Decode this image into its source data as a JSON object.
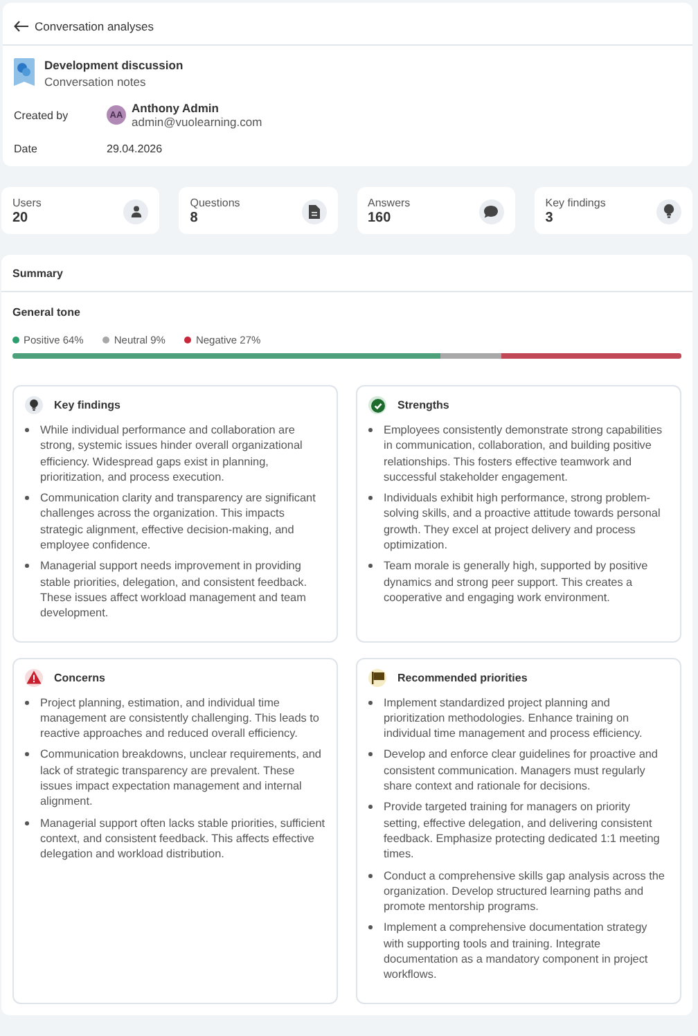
{
  "header": {
    "back_label": "Conversation analyses",
    "title": "Development discussion",
    "subtitle": "Conversation notes",
    "created_by_label": "Created by",
    "avatar_initials": "AA",
    "creator_name": "Anthony Admin",
    "creator_email": "admin@vuolearning.com",
    "date_label": "Date",
    "date": "29.04.2026"
  },
  "stats": [
    {
      "label": "Users",
      "value": "20",
      "kind": "user"
    },
    {
      "label": "Questions",
      "value": "8",
      "kind": "document"
    },
    {
      "label": "Answers",
      "value": "160",
      "kind": "chat"
    },
    {
      "label": "Key findings",
      "value": "3",
      "kind": "bulb"
    }
  ],
  "summary": {
    "title": "Summary",
    "tone_title": "General tone",
    "tones": [
      {
        "label": "Positive 64%",
        "color": "#2e9e6e",
        "level": 0.64
      },
      {
        "label": "Neutral 9%",
        "color": "#a8a8a8"
      },
      {
        "label": "Negative 27%",
        "color": "#c8283c",
        "level": 0.27
      }
    ],
    "sections": [
      {
        "title": "Key findings",
        "kind": "bulb",
        "items": [
          "While individual performance and collaboration are strong, systemic issues hinder overall organizational efficiency. Widespread gaps exist in planning, prioritization, and process execution.",
          "Communication clarity and transparency are significant challenges across the organization. This impacts strategic alignment, effective decision-making, and employee confidence.",
          "Managerial support needs improvement in providing stable priorities, delegation, and consistent feedback. These issues affect workload management and team development."
        ]
      },
      {
        "title": "Strengths",
        "kind": "check",
        "items": [
          "Employees consistently demonstrate strong capabilities in communication, collaboration, and building positive relationships. This fosters effective teamwork and successful stakeholder engagement.",
          "Individuals exhibit high performance, strong problem-solving skills, and a proactive attitude towards personal growth. They excel at project delivery and process optimization.",
          "Team morale is generally high, supported by positive dynamics and strong peer support. This creates a cooperative and engaging work environment."
        ]
      },
      {
        "title": "Concerns",
        "kind": "warning",
        "items": [
          "Project planning, estimation, and individual time management are consistently challenging. This leads to reactive approaches and reduced overall efficiency.",
          "Communication breakdowns, unclear requirements, and lack of strategic transparency are prevalent. These issues impact expectation management and internal alignment.",
          "Managerial support often lacks stable priorities, sufficient context, and consistent feedback. This affects effective delegation and workload distribution."
        ]
      },
      {
        "title": "Recommended priorities",
        "kind": "flag",
        "items": [
          "Implement standardized project planning and prioritization methodologies. Enhance training on individual time management and process efficiency.",
          "Develop and enforce clear guidelines for proactive and consistent communication. Managers must regularly share context and rationale for decisions.",
          "Provide targeted training for managers on priority setting, effective delegation, and delivering consistent feedback. Emphasize protecting dedicated 1:1 meeting times.",
          "Conduct a comprehensive skills gap analysis across the organization. Develop structured learning paths and promote mentorship programs.",
          "Implement a comprehensive documentation strategy with supporting tools and training. Integrate documentation as a mandatory component in project workflows."
        ]
      }
    ]
  }
}
